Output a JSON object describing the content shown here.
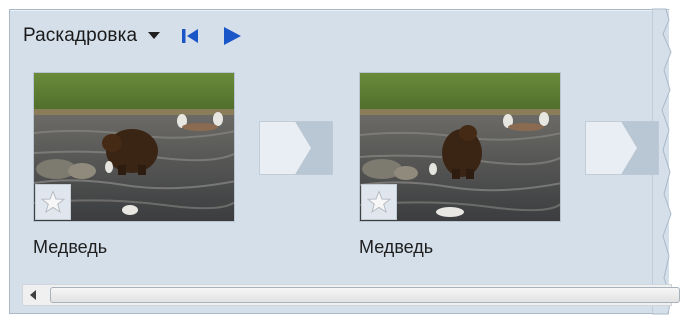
{
  "toolbar": {
    "view_label": "Раскадровка",
    "dropdown_icon": "chevron-down-icon",
    "go_start_icon": "skip-to-start-icon",
    "play_icon": "play-icon",
    "accent": "#1a56c8"
  },
  "clips": [
    {
      "label": "Медведь",
      "thumbnail": "bear-in-river-image",
      "rating_icon": "star-icon"
    },
    {
      "label": "Медведь",
      "thumbnail": "bear-in-river-image",
      "rating_icon": "star-icon"
    }
  ],
  "transitions": [
    {
      "icon": "transition-arrow-icon"
    },
    {
      "icon": "transition-arrow-icon"
    }
  ],
  "colors": {
    "panel_bg": "#d5dfea",
    "label_text": "#1e1e1e"
  }
}
